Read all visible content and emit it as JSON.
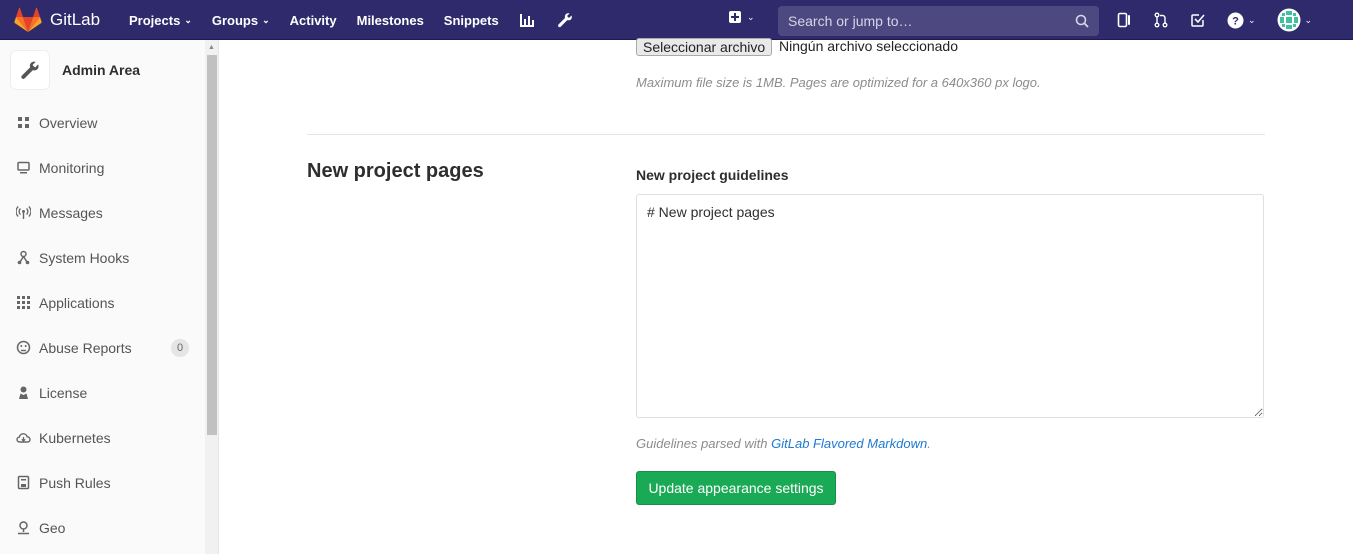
{
  "topnav": {
    "brand": "GitLab",
    "links": [
      {
        "label": "Projects",
        "has_dropdown": true
      },
      {
        "label": "Groups",
        "has_dropdown": true
      },
      {
        "label": "Activity",
        "has_dropdown": false
      },
      {
        "label": "Milestones",
        "has_dropdown": false
      },
      {
        "label": "Snippets",
        "has_dropdown": false
      }
    ],
    "icons": [
      "chart-icon",
      "wrench-icon",
      "plus-square-icon",
      "sidebar-toggle-icon",
      "merge-request-icon",
      "todo-check-icon",
      "help-icon",
      "user-avatar"
    ],
    "search": {
      "placeholder": "Search or jump to…",
      "value": ""
    },
    "colors": {
      "nav_bg": "#2f2a6b",
      "search_bg": "#4d4880"
    }
  },
  "sidebar": {
    "title": "Admin Area",
    "items": [
      {
        "label": "Overview",
        "icon": "overview-grid-icon"
      },
      {
        "label": "Monitoring",
        "icon": "monitor-icon"
      },
      {
        "label": "Messages",
        "icon": "broadcast-icon"
      },
      {
        "label": "System Hooks",
        "icon": "hook-icon"
      },
      {
        "label": "Applications",
        "icon": "apps-grid-icon"
      },
      {
        "label": "Abuse Reports",
        "icon": "abuse-face-icon",
        "badge": "0"
      },
      {
        "label": "License",
        "icon": "license-icon"
      },
      {
        "label": "Kubernetes",
        "icon": "kubernetes-cloud-icon"
      },
      {
        "label": "Push Rules",
        "icon": "push-rules-icon"
      },
      {
        "label": "Geo",
        "icon": "geo-pin-icon"
      }
    ]
  },
  "main": {
    "file_input": {
      "button_label": "Seleccionar archivo",
      "status": "Ningún archivo seleccionado"
    },
    "logo_help": "Maximum file size is 1MB. Pages are optimized for a 640x360 px logo.",
    "section_title": "New project pages",
    "guidelines_label": "New project guidelines",
    "guidelines_value": "# New project pages",
    "guidelines_help_prefix": "Guidelines parsed with ",
    "guidelines_help_link": "GitLab Flavored Markdown",
    "guidelines_help_suffix": ".",
    "submit_label": "Update appearance settings",
    "colors": {
      "submit_bg": "#1aaa55",
      "link": "#1f78d1"
    }
  }
}
